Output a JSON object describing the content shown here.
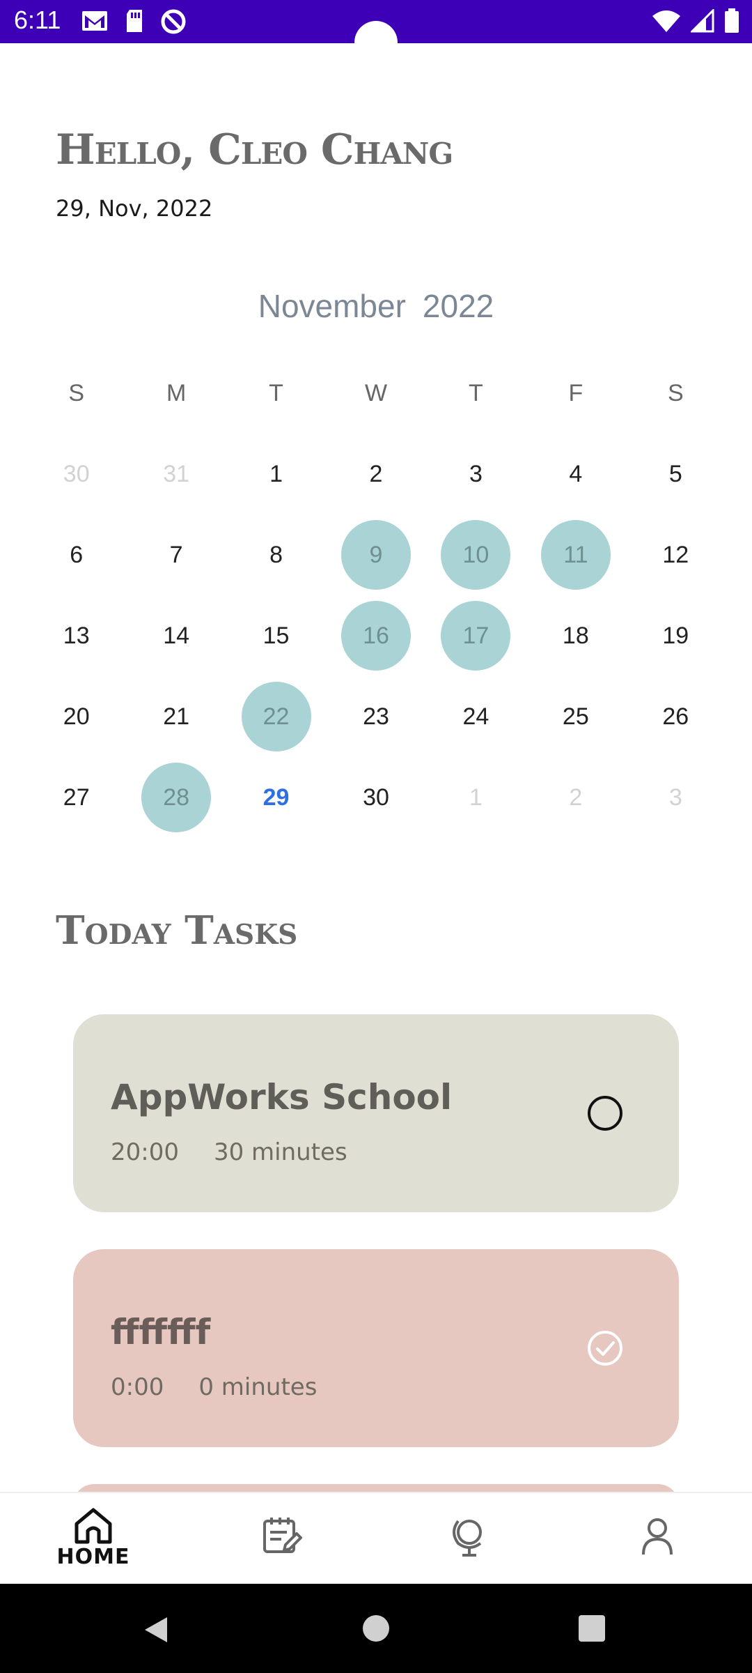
{
  "status_bar": {
    "time": "6:11",
    "left_icons": [
      "gmail-icon",
      "sd-card-icon",
      "dnd-icon"
    ],
    "right_icons": [
      "wifi-icon",
      "signal-icon",
      "battery-icon"
    ],
    "background": "#3d00b6"
  },
  "header": {
    "greeting": "Hello, Cleo Chang",
    "date": "29, Nov, 2022"
  },
  "calendar": {
    "month": "November",
    "year": "2022",
    "weekdays": [
      "S",
      "M",
      "T",
      "W",
      "T",
      "F",
      "S"
    ],
    "weeks": [
      [
        {
          "d": "30",
          "o": true
        },
        {
          "d": "31",
          "o": true
        },
        {
          "d": "1"
        },
        {
          "d": "2"
        },
        {
          "d": "3"
        },
        {
          "d": "4"
        },
        {
          "d": "5"
        }
      ],
      [
        {
          "d": "6"
        },
        {
          "d": "7"
        },
        {
          "d": "8"
        },
        {
          "d": "9",
          "m": true
        },
        {
          "d": "10",
          "m": true
        },
        {
          "d": "11",
          "m": true
        },
        {
          "d": "12"
        }
      ],
      [
        {
          "d": "13"
        },
        {
          "d": "14"
        },
        {
          "d": "15"
        },
        {
          "d": "16",
          "m": true
        },
        {
          "d": "17",
          "m": true
        },
        {
          "d": "18"
        },
        {
          "d": "19"
        }
      ],
      [
        {
          "d": "20"
        },
        {
          "d": "21"
        },
        {
          "d": "22",
          "m": true
        },
        {
          "d": "23"
        },
        {
          "d": "24"
        },
        {
          "d": "25"
        },
        {
          "d": "26"
        }
      ],
      [
        {
          "d": "27"
        },
        {
          "d": "28",
          "m": true
        },
        {
          "d": "29",
          "t": true
        },
        {
          "d": "30"
        },
        {
          "d": "1",
          "o": true
        },
        {
          "d": "2",
          "o": true
        },
        {
          "d": "3",
          "o": true
        }
      ]
    ],
    "marked_color": "#a9d3d4",
    "today_color": "#2f6fe6"
  },
  "tasks": {
    "title": "Today Tasks",
    "items": [
      {
        "name": "AppWorks School",
        "time": "20:00",
        "duration": "30 minutes",
        "done": false,
        "color": "#e0dfd3"
      },
      {
        "name": "fffffff",
        "time": "0:00",
        "duration": "0 minutes",
        "done": true,
        "color": "#e6c8c1"
      }
    ]
  },
  "bottom_nav": {
    "items": [
      {
        "icon": "home-icon",
        "label": "HOME",
        "active": true
      },
      {
        "icon": "calendar-edit-icon",
        "label": "",
        "active": false
      },
      {
        "icon": "globe-icon",
        "label": "",
        "active": false
      },
      {
        "icon": "profile-icon",
        "label": "",
        "active": false
      }
    ]
  }
}
